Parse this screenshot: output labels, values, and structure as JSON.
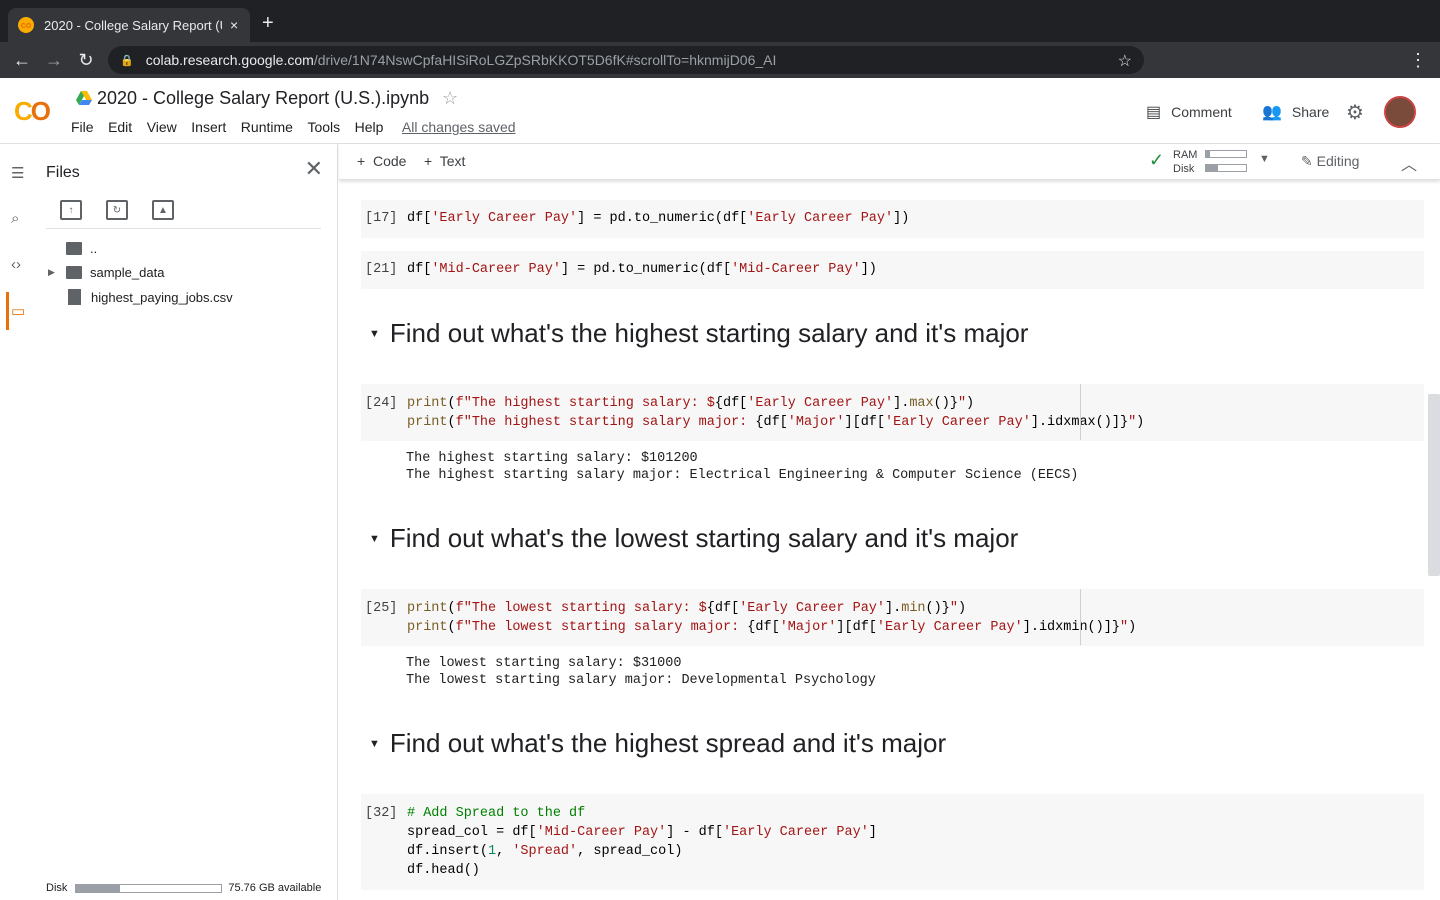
{
  "browser": {
    "tab_title": "2020 - College Salary Report (U.S.).ipynb",
    "url_host": "colab.research.google.com",
    "url_path": "/drive/1N74NswCpfaHISiRoLGZpSRbKKOT5D6fK#scrollTo=hknmijD06_AI",
    "close_icon": "×",
    "new_tab_icon": "+"
  },
  "colab": {
    "title": "2020 - College Salary Report (U.S.).ipynb",
    "menu": [
      "File",
      "Edit",
      "View",
      "Insert",
      "Runtime",
      "Tools",
      "Help"
    ],
    "saved_status": "All changes saved",
    "comment_label": "Comment",
    "share_label": "Share"
  },
  "files_panel": {
    "title": "Files",
    "items": [
      "..",
      "sample_data",
      "highest_paying_jobs.csv"
    ],
    "disk_label": "Disk",
    "disk_available": "75.76 GB available",
    "disk_used_fraction": 0.3
  },
  "nb_toolbar": {
    "code_label": "Code",
    "text_label": "Text",
    "ram_label": "RAM",
    "disk_label": "Disk",
    "ram_fraction": 0.1,
    "disk_fraction": 0.3,
    "editing_label": "Editing"
  },
  "cells": {
    "c17_num": "[17]",
    "c21_num": "[21]",
    "h1": "Find out what's the highest starting salary and it's major",
    "c24_num": "[24]",
    "c24_out1": "The highest starting salary: $101200",
    "c24_out2": "The highest starting salary major: Electrical Engineering & Computer Science (EECS)",
    "h2": "Find out what's the lowest starting salary and it's major",
    "c25_num": "[25]",
    "c25_out1": "The lowest starting salary: $31000",
    "c25_out2": "The lowest starting salary major: Developmental Psychology",
    "h3": "Find out what's the highest spread and it's major",
    "c32_num": "[32]"
  },
  "colors": {
    "accent": "#e8710a",
    "string": "#a31515",
    "func": "#795e26",
    "comment": "#008000",
    "number": "#098658"
  }
}
